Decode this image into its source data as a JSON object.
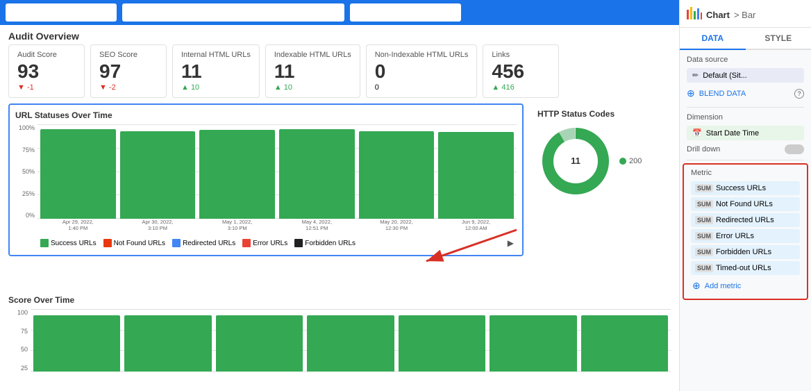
{
  "topbar": {
    "inputs": [
      "",
      "",
      ""
    ]
  },
  "panel_header": {
    "title": "Chart",
    "breadcrumb": "> Bar",
    "icon": "📊"
  },
  "panel_tabs": {
    "active": "DATA",
    "tabs": [
      "DATA",
      "STYLE"
    ]
  },
  "data_source": {
    "label": "Data source",
    "item": "Default (Sit...",
    "blend_label": "BLEND DATA"
  },
  "dimension": {
    "label": "Dimension",
    "item": "Start Date Time"
  },
  "drill_down": {
    "label": "Drill down"
  },
  "metric": {
    "label": "Metric",
    "items": [
      "Success URLs",
      "Not Found URLs",
      "Redirected URLs",
      "Error URLs",
      "Forbidden URLs",
      "Timed-out URLs"
    ],
    "add_label": "Add metric"
  },
  "audit": {
    "title": "Audit Overview",
    "metrics": [
      {
        "label": "Audit Score",
        "value": "93",
        "change": "▼ -1",
        "type": "negative"
      },
      {
        "label": "SEO Score",
        "value": "97",
        "change": "▼ -2",
        "type": "negative"
      },
      {
        "label": "Internal HTML URLs",
        "value": "11",
        "change": "▲ 10",
        "type": "positive"
      },
      {
        "label": "Indexable HTML URLs",
        "value": "11",
        "change": "▲ 10",
        "type": "positive"
      },
      {
        "label": "Non-Indexable HTML URLs",
        "value": "0",
        "change": "0",
        "type": "neutral"
      },
      {
        "label": "Links",
        "value": "456",
        "change": "▲ 416",
        "type": "positive"
      }
    ]
  },
  "url_statuses": {
    "title": "URL Statuses Over Time",
    "y_labels": [
      "100%",
      "75%",
      "50%",
      "25%",
      "0%"
    ],
    "bars": [
      95,
      93,
      94,
      95,
      93,
      92
    ],
    "x_labels": [
      "Apr 29, 2022, 1:40 PM",
      "Apr 30, 2022, 3:10 PM",
      "May 1, 2022, 3:10 PM",
      "May 4, 2022, 12:51 PM",
      "May 20, 2022, 12:30 PM",
      "Jun 9, 2022, 12:00 AM"
    ],
    "legend": [
      {
        "label": "Success URLs",
        "color": "#34a853"
      },
      {
        "label": "Not Found URLs",
        "color": "#e8390e"
      },
      {
        "label": "Redirected URLs",
        "color": "#4285f4"
      },
      {
        "label": "Error URLs",
        "color": "#ea4335"
      },
      {
        "label": "Forbidden URLs",
        "color": "#212121"
      }
    ]
  },
  "http_status": {
    "title": "HTTP Status Codes",
    "center_value": "11",
    "legend_value": "200"
  },
  "score_over_time": {
    "title": "Score Over Time",
    "y_labels": [
      "100",
      "75",
      "50",
      "25"
    ],
    "bars": [
      90,
      90,
      90,
      90,
      90,
      90,
      90
    ]
  }
}
